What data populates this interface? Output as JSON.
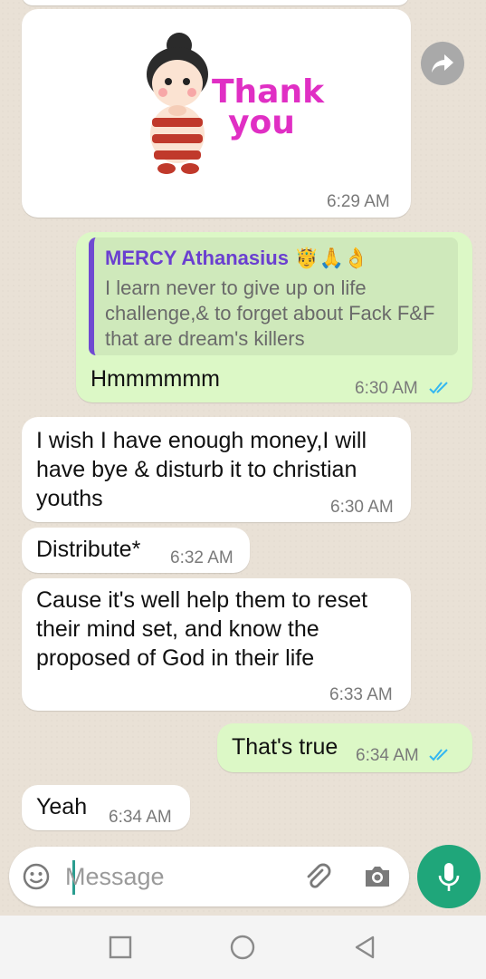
{
  "messages": [
    {
      "text": "",
      "time": "6:29 AM",
      "type": "sticker",
      "sticker_text": "Thank you"
    },
    {
      "quote_name": "MERCY Athanasius",
      "quote_emoji": "🤴🙏👌",
      "quote_text": "I learn never to give up on life challenge,& to forget about Fack F&F that are dream's killers",
      "text": "Hmmmmmm",
      "time": "6:30 AM"
    },
    {
      "text": "I wish I have enough money,I will have bye & disturb it to christian youths",
      "time": "6:30 AM"
    },
    {
      "text": "Distribute*",
      "time": "6:32 AM"
    },
    {
      "text": "Cause it's well help them to reset their mind set, and know the proposed of God in their life",
      "time": "6:33 AM"
    },
    {
      "text": "That's true",
      "time": "6:34 AM"
    },
    {
      "text": "Yeah",
      "time": "6:34 AM"
    }
  ],
  "input": {
    "placeholder": "Message"
  },
  "colors": {
    "incoming": "#ffffff",
    "outgoing": "#dcf8c6",
    "accent": "#1fa67a",
    "read_ticks": "#34b7f1",
    "quote_name": "#6a3fd0"
  },
  "icons": [
    "forward-icon",
    "emoji-icon",
    "attach-icon",
    "camera-icon",
    "mic-icon",
    "recent-apps-icon",
    "home-icon",
    "back-icon",
    "read-ticks-icon"
  ]
}
